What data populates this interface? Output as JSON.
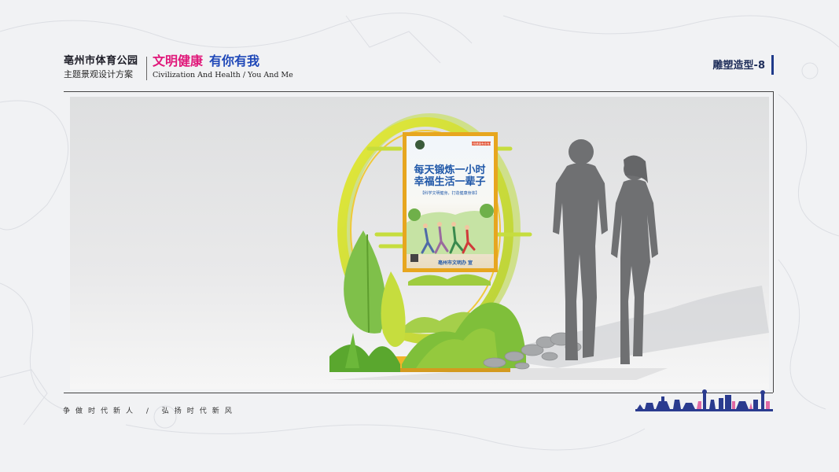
{
  "header": {
    "park_name": "亳州市体育公园",
    "plan_name": "主题景观设计方案",
    "slogan_part1": "文明健康",
    "slogan_part2": "有你有我",
    "slogan_en": "Civilization And Health / You And Me",
    "page_label": "雕塑造型-8"
  },
  "poster": {
    "line1": "每天锻炼一小时",
    "line2": "幸福生活一辈子",
    "subline": "【科学文明健身，打造健康身体】",
    "footer": "亳州市文明办 宣",
    "tag": "文明健康有你有我"
  },
  "footer": {
    "slogan": "争做时代新人 / 弘扬时代新风"
  },
  "colors": {
    "slogan_pink": "#e0187a",
    "slogan_blue": "#1f48b8",
    "sculpture_green": "#8cc63f",
    "sculpture_lime": "#d7e23c",
    "skyline_blue": "#2a3b8f",
    "skyline_pink": "#e06aa5"
  }
}
